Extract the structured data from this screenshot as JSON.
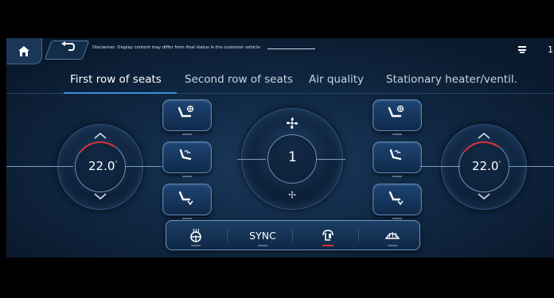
{
  "header": {
    "disclaimer": "Disclaimer: Display content may differ from final status in the customer vehicle",
    "top_right_number": "1",
    "home_icon": "home-icon",
    "back_icon": "back-arrow-icon"
  },
  "tabs": [
    {
      "label": "First row of seats",
      "active": true
    },
    {
      "label": "Second row of seats",
      "active": false
    },
    {
      "label": "Air quality",
      "active": false
    },
    {
      "label": "Stationary heater/ventil.",
      "active": false
    }
  ],
  "left_temp": {
    "value": "22.0",
    "unit": "°"
  },
  "right_temp": {
    "value": "22.0",
    "unit": "°"
  },
  "fan": {
    "level": "1"
  },
  "bottom_bar": {
    "items": [
      {
        "icon": "steering-wheel-heat-icon"
      },
      {
        "label": "SYNC"
      },
      {
        "icon": "climate-mode-icon",
        "active": true
      },
      {
        "icon": "windshield-defrost-icon"
      }
    ]
  },
  "colors": {
    "accent_blue": "#3c8fe0",
    "active_red": "#e0303c",
    "background": "#112a47"
  }
}
